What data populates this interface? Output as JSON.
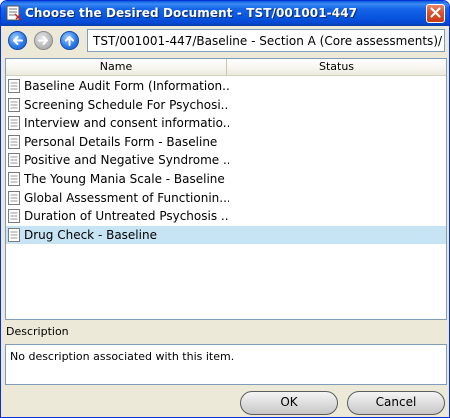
{
  "window": {
    "title": "Choose the Desired Document - TST/001001-447"
  },
  "navigation": {
    "back_icon": "back-arrow-icon",
    "forward_icon": "forward-arrow-icon",
    "up_icon": "up-arrow-icon",
    "path": "TST/001001-447/Baseline - Section A (Core assessments)/"
  },
  "list": {
    "columns": [
      "Name",
      "Status"
    ],
    "rows": [
      {
        "name": "Baseline Audit Form (Information...",
        "status": ""
      },
      {
        "name": "Screening Schedule For Psychosi...",
        "status": ""
      },
      {
        "name": "Interview and consent informatio...",
        "status": ""
      },
      {
        "name": "Personal Details Form - Baseline",
        "status": ""
      },
      {
        "name": "Positive and Negative Syndrome ...",
        "status": ""
      },
      {
        "name": "The Young Mania Scale - Baseline",
        "status": ""
      },
      {
        "name": "Global Assessment of Functionin...",
        "status": ""
      },
      {
        "name": "Duration of Untreated Psychosis ...",
        "status": ""
      },
      {
        "name": "Drug Check - Baseline",
        "status": ""
      }
    ],
    "selected_index": 8
  },
  "description": {
    "label": "Description",
    "text": "No description associated with this item."
  },
  "buttons": {
    "ok": "OK",
    "cancel": "Cancel"
  },
  "colors": {
    "titlebar": "#0a58e0",
    "selection": "#c6e4f3",
    "dialog_bg": "#ece9d8"
  }
}
